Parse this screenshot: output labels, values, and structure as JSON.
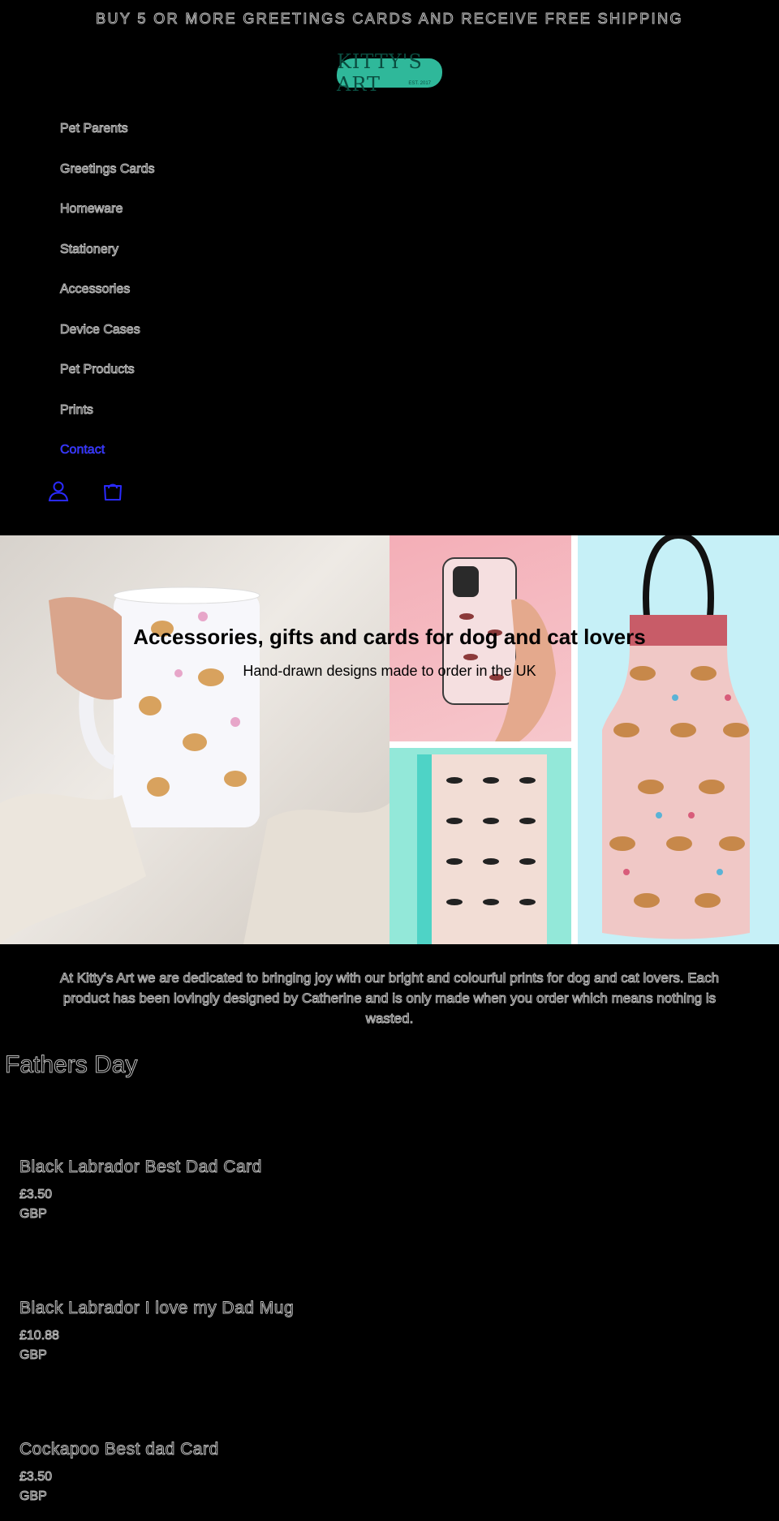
{
  "announcement": "BUY 5 OR MORE GREETINGS CARDS AND RECEIVE FREE SHIPPING",
  "logo": {
    "text": "KITTY'S ART",
    "tagline": "EST. 2017"
  },
  "nav": {
    "items": [
      {
        "label": "Pet Parents"
      },
      {
        "label": "Greetings Cards"
      },
      {
        "label": "Homeware"
      },
      {
        "label": "Stationery"
      },
      {
        "label": "Accessories"
      },
      {
        "label": "Device Cases"
      },
      {
        "label": "Pet Products"
      },
      {
        "label": "Prints"
      },
      {
        "label": "Contact"
      }
    ]
  },
  "icons": {
    "account": "account-icon",
    "cart": "bag-icon"
  },
  "hero": {
    "title": "Accessories, gifts and cards for dog and cat lovers",
    "subtitle": "Hand-drawn designs made to order in the UK"
  },
  "intro": "At Kitty's Art we are dedicated to bringing joy with our bright and colourful prints for dog and cat lovers. Each product has been lovingly designed by Catherine and is only made when you order which means nothing is wasted.",
  "collection": {
    "title": "Fathers Day",
    "products": [
      {
        "name": "Black Labrador Best Dad Card",
        "price": "£3.50",
        "currency": "GBP"
      },
      {
        "name": "Black Labrador I love my Dad Mug",
        "price": "£10.88",
        "currency": "GBP"
      },
      {
        "name": "Cockapoo Best dad Card",
        "price": "£3.50",
        "currency": "GBP"
      }
    ]
  },
  "colors": {
    "background": "#000000",
    "logo": "#2fb89a",
    "active_link": "#2a2aff"
  }
}
